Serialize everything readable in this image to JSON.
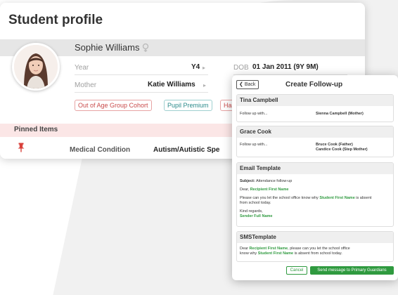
{
  "profile": {
    "title": "Student profile",
    "name": "Sophie Williams",
    "year_label": "Year",
    "year_value": "Y4",
    "dob_label": "DOB",
    "dob_value": "01 Jan 2011 (9Y 9M)",
    "mother_label": "Mother",
    "mother_value": "Katie Williams",
    "tags": [
      "Out of Age Group Cohort",
      "Pupil Premium",
      "Has"
    ],
    "pinned_label": "Pinned Items",
    "medical_label": "Medical Condition",
    "medical_value": "Autism/Autistic Spe"
  },
  "modal": {
    "back_label": "Back",
    "title": "Create Follow-up",
    "contacts": [
      {
        "name": "Tina Campbell",
        "follow_label": "Follow up with...",
        "people": [
          "Sienna Campbell (Mother)"
        ]
      },
      {
        "name": "Grace Cook",
        "follow_label": "Follow up with...",
        "people": [
          "Bruce Cook (Father)",
          "Candice Cook (Step Mother)"
        ]
      }
    ],
    "email": {
      "heading": "Email Template",
      "subject_label": "Subject:",
      "subject_value": "Attendance follow-up",
      "dear": "Dear,",
      "recipient_token": "Recipient First Name",
      "body_1": "Please can you let the school office know why",
      "student_token": "Student First Name",
      "body_2": "is absent",
      "body_3": "from school today.",
      "regards": "Kind regards,",
      "sender_token": "Sender Full Name"
    },
    "sms": {
      "heading": "SMSTemplate",
      "dear": "Dear",
      "recipient_token": "Recipient First Name",
      "body_1": ", please can you let the school office",
      "body_2": "know why",
      "student_token": "Student First Name",
      "body_3": "is absent from school today."
    },
    "cancel_label": "Cancel",
    "send_label": "Send message to Primary Guardians"
  },
  "colors": {
    "accent_green": "#2f9a3f",
    "tag_red": "#c94a4a",
    "tag_teal": "#2a8a8a",
    "pinned_band": "#fbe6e6"
  },
  "icons": [
    "female-gender-icon",
    "pin-icon",
    "back-chevron-icon",
    "caret-right-icon"
  ]
}
